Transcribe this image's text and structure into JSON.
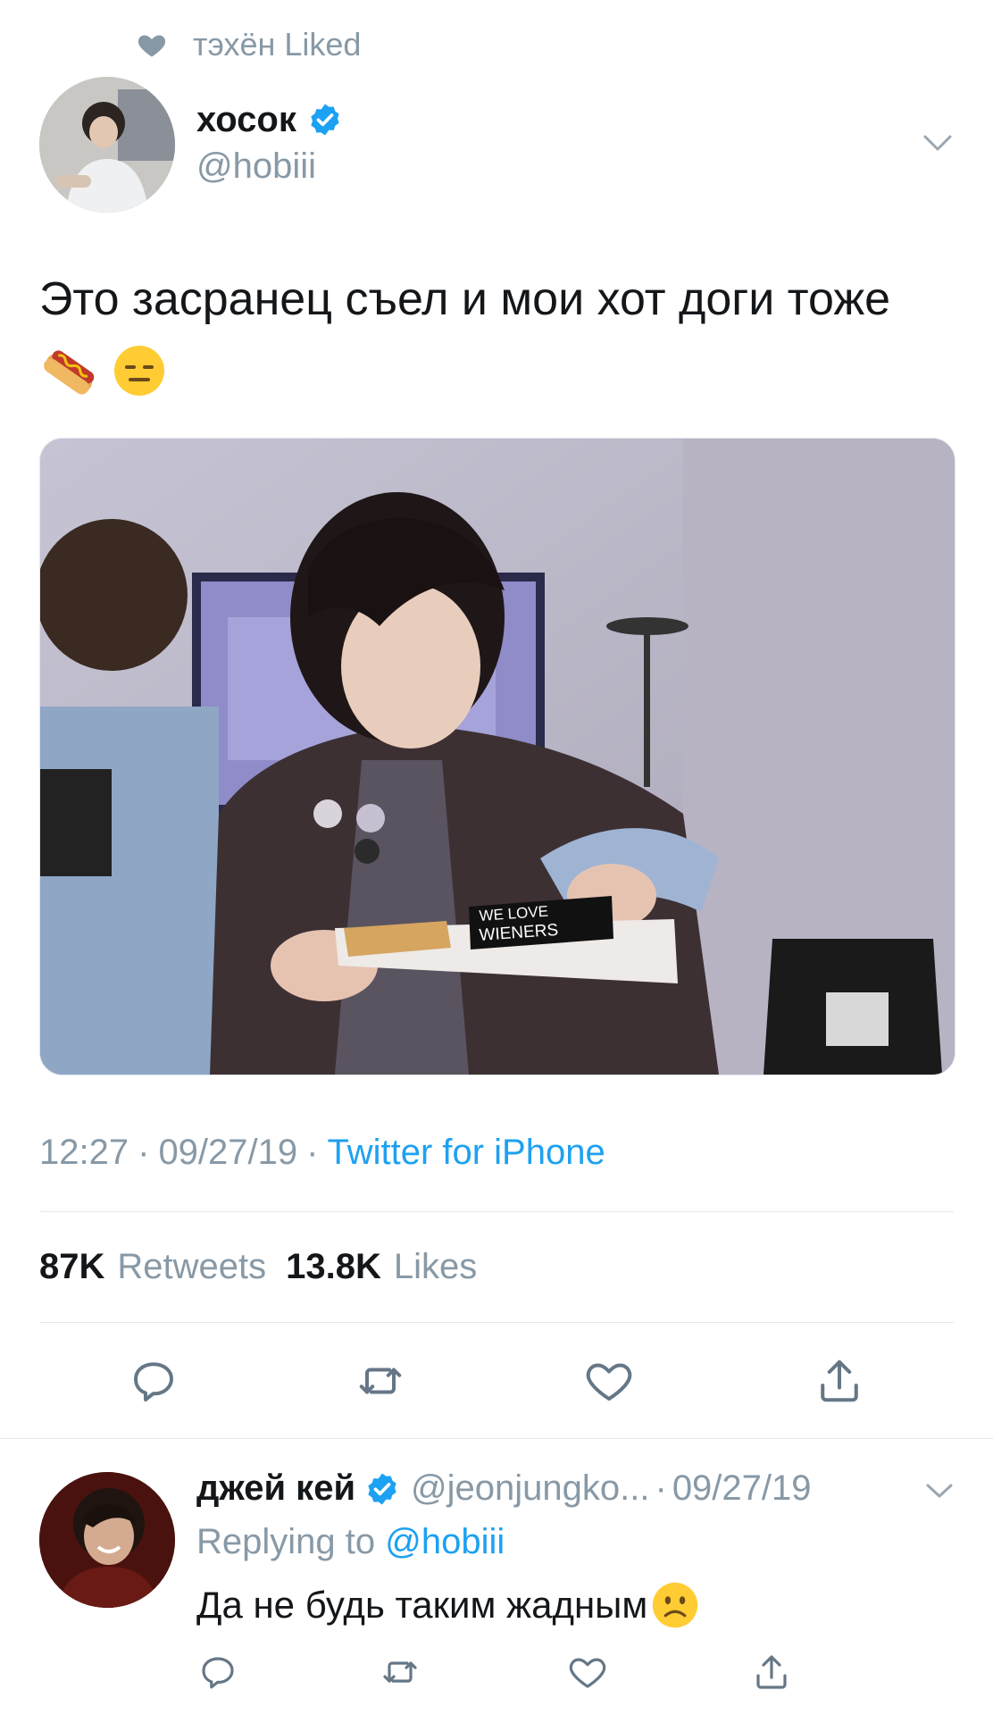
{
  "context": {
    "icon": "heart-icon",
    "text": "тэхён Liked"
  },
  "tweet": {
    "author_name": "хосок",
    "author_handle": "@hobiii",
    "verified": true,
    "text": "Это засранец съел и мои хот доги тоже",
    "emojis": [
      "hot-dog-emoji",
      "expressionless-face-emoji"
    ],
    "photo": {
      "alt": "Photo",
      "box_text_line1": "WE LOVE",
      "box_text_line2": "WIENERS"
    },
    "time": "12:27",
    "date": "09/27/19",
    "source": "Twitter for iPhone",
    "retweets_count": "87K",
    "retweets_label": "Retweets",
    "likes_count": "13.8K",
    "likes_label": "Likes"
  },
  "reply": {
    "author_name": "джей кей",
    "verified": true,
    "author_handle": "@jeonjungko...",
    "date": "09/27/19",
    "replying_prefix": "Replying to",
    "replying_to": "@hobiii",
    "text": "Да не будь таким жадным",
    "emoji": "slightly-frowning-face-emoji"
  },
  "colors": {
    "accent": "#1da1f2",
    "muted": "#8899a6",
    "text": "#14171a",
    "divider": "#e1e8ed"
  },
  "separator": "·"
}
